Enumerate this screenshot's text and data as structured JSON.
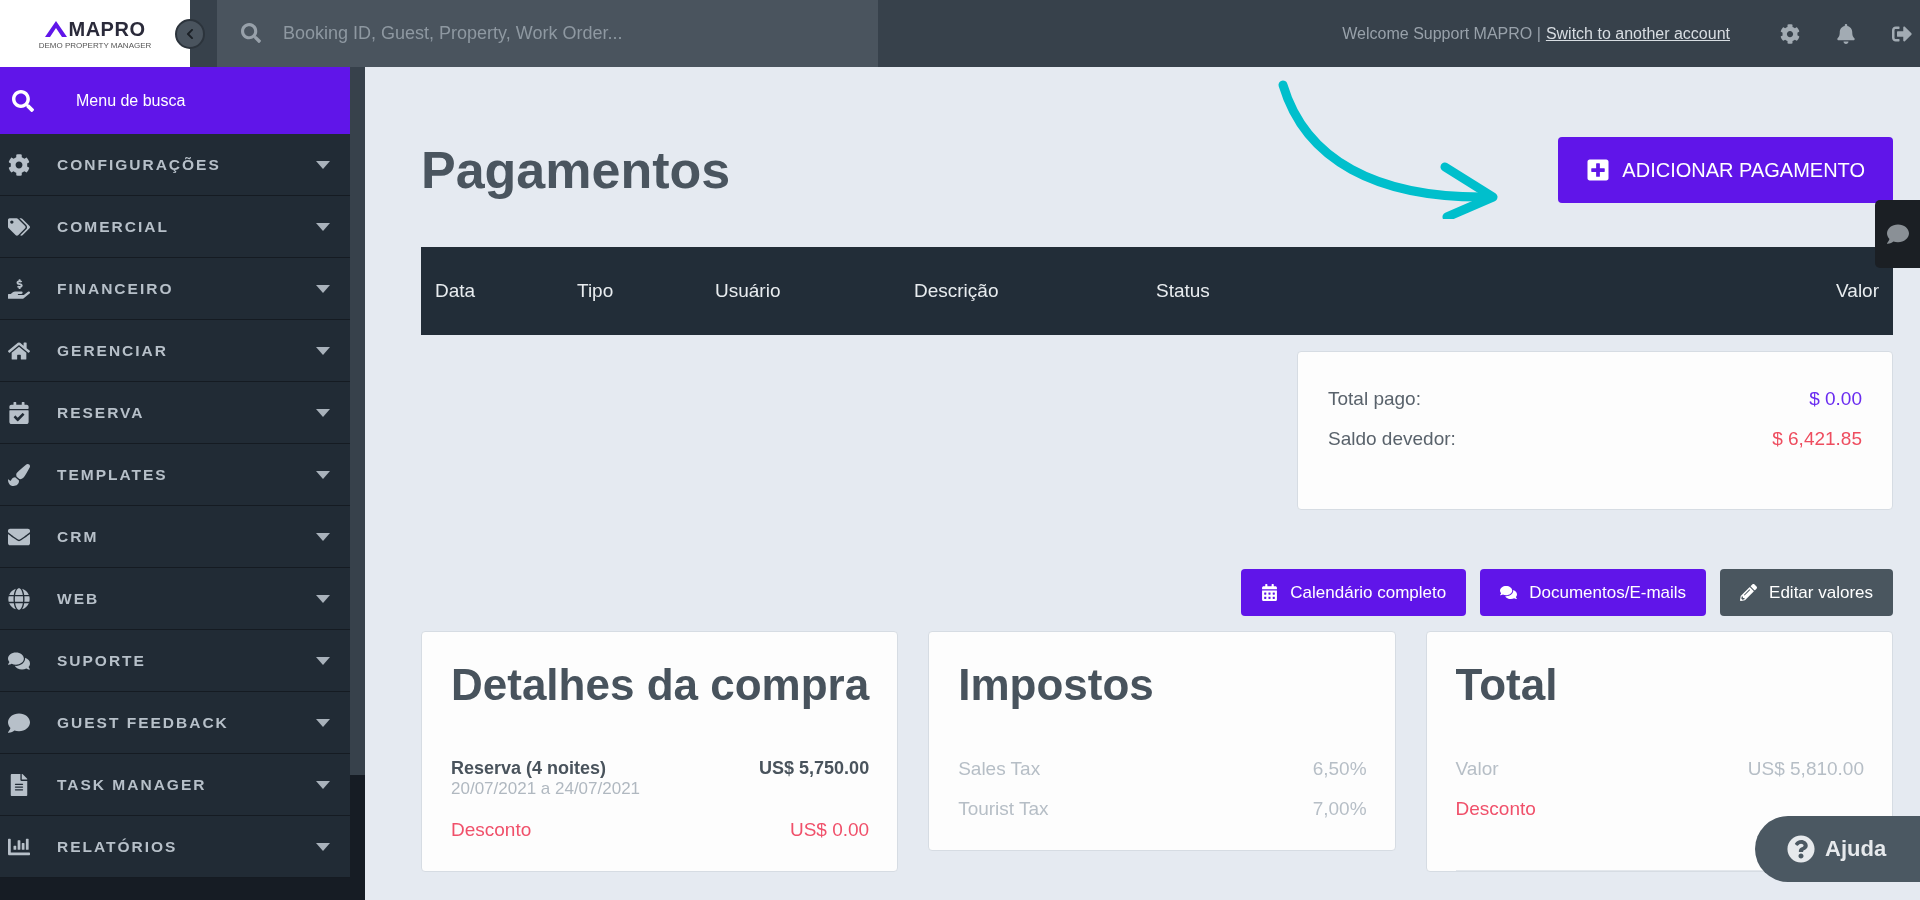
{
  "logo": {
    "name": "MAPRO",
    "tagline": "DEMO PROPERTY MANAGER"
  },
  "search": {
    "placeholder": "Booking ID, Guest, Property, Work Order..."
  },
  "header": {
    "welcome": "Welcome Support MAPRO |",
    "switch_link": "Switch to another account"
  },
  "sidebar": {
    "search_label": "Menu de busca",
    "items": [
      {
        "label": "CONFIGURAÇÕES",
        "expanded": false
      },
      {
        "label": "COMERCIAL",
        "expanded": false
      },
      {
        "label": "FINANCEIRO",
        "expanded": false
      },
      {
        "label": "GERENCIAR",
        "expanded": false
      },
      {
        "label": "RESERVA",
        "expanded": false
      },
      {
        "label": "TEMPLATES",
        "expanded": false
      },
      {
        "label": "CRM",
        "expanded": false
      },
      {
        "label": "WEB",
        "expanded": false
      },
      {
        "label": "SUPORTE",
        "expanded": false
      },
      {
        "label": "GUEST FEEDBACK",
        "expanded": false
      },
      {
        "label": "TASK MANAGER",
        "expanded": false
      },
      {
        "label": "RELATÓRIOS",
        "expanded": false
      }
    ]
  },
  "page_title": "Pagamentos",
  "add_button": "ADICIONAR PAGAMENTO",
  "table": {
    "columns": [
      "Data",
      "Tipo",
      "Usuário",
      "Descrição",
      "Status",
      "Valor"
    ]
  },
  "summary": [
    {
      "label": "Total pago:",
      "value": "$ 0.00",
      "kind": "paid"
    },
    {
      "label": "Saldo devedor:",
      "value": "$ 6,421.85",
      "kind": "due"
    }
  ],
  "actions": [
    {
      "label": "Calendário completo",
      "kind": "primary"
    },
    {
      "label": "Documentos/E-mails",
      "kind": "primary"
    },
    {
      "label": "Editar valores",
      "kind": "secondary"
    }
  ],
  "details": {
    "title": "Detalhes da compra",
    "item": {
      "label": "Reserva (4 noites)",
      "dates": "20/07/2021 a 24/07/2021",
      "value": "US$ 5,750.00"
    },
    "discount": {
      "label": "Desconto",
      "value": "US$ 0.00"
    }
  },
  "taxes": {
    "title": "Impostos",
    "rows": [
      {
        "label": "Sales Tax",
        "value": "6,50%"
      },
      {
        "label": "Tourist Tax",
        "value": "7,00%"
      }
    ]
  },
  "total": {
    "title": "Total",
    "rows": [
      {
        "label": "Valor",
        "value": "US$ 5,810.00",
        "kind": "plain"
      },
      {
        "label": "Desconto",
        "kind": "discount"
      }
    ]
  },
  "help_button": "Ajuda"
}
